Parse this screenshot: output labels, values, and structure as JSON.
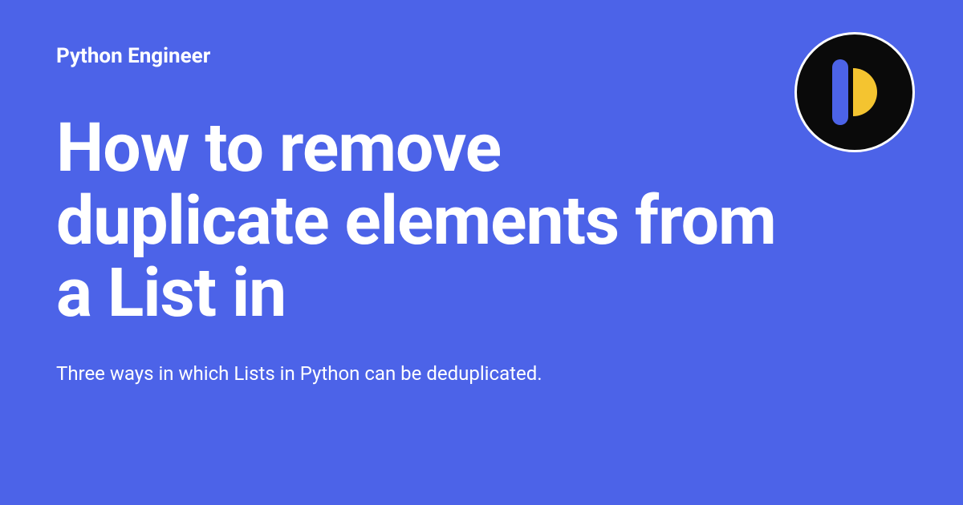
{
  "site_name": "Python Engineer",
  "title": "How to remove duplicate elements from a List in",
  "subtitle": "Three ways in which Lists in Python can be deduplicated.",
  "colors": {
    "background": "#4c63e8",
    "text": "#ffffff",
    "logo_bg": "#0a0a0a",
    "logo_bar": "#4c63e8",
    "logo_half": "#f4c430"
  }
}
